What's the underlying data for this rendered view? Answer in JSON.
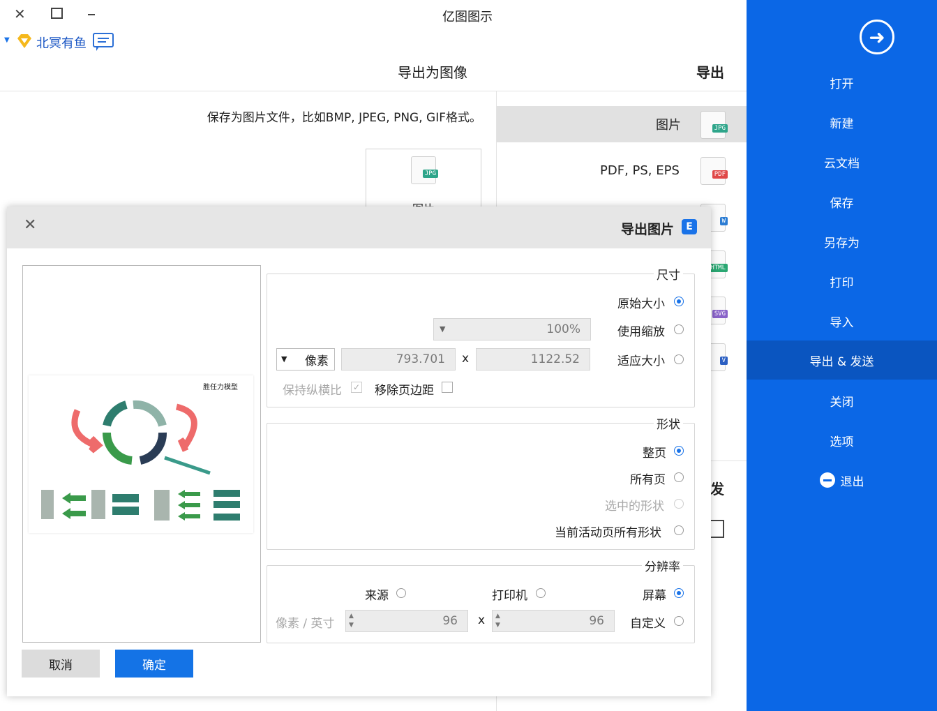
{
  "window": {
    "title": "亿图图示",
    "user_name": "北冥有鱼"
  },
  "header": {
    "section_title": "导出",
    "page_title": "导出为图像",
    "description": "保存为图片文件，比如BMP, JPEG, PNG, GIF格式。",
    "partial_side_text": "发"
  },
  "sidebar": {
    "items": [
      {
        "label": "打开"
      },
      {
        "label": "新建"
      },
      {
        "label": "云文档"
      },
      {
        "label": "保存"
      },
      {
        "label": "另存为"
      },
      {
        "label": "打印"
      },
      {
        "label": "导入"
      },
      {
        "label": "导出 & 发送"
      },
      {
        "label": "关闭"
      },
      {
        "label": "选项"
      },
      {
        "label": "退出"
      }
    ],
    "active_index": 7
  },
  "formats": [
    {
      "label": "图片",
      "badge": "JPG",
      "color": "#2ea58a"
    },
    {
      "label": "PDF, PS, EPS",
      "badge": "PDF",
      "color": "#e04848"
    },
    {
      "label": "",
      "badge": "W",
      "color": "#2b7cd3"
    },
    {
      "label": "",
      "badge": "HTML",
      "color": "#2aa772"
    },
    {
      "label": "",
      "badge": "SVG",
      "color": "#8a63c9"
    },
    {
      "label": "",
      "badge": "V",
      "color": "#2b5fc2"
    }
  ],
  "tile": {
    "label": "图片",
    "badge": "JPG"
  },
  "dialog": {
    "title": "导出图片",
    "size": {
      "title": "尺寸",
      "opt_original": "原始大小",
      "opt_scale": "使用缩放",
      "scale_value": "100%",
      "opt_fit": "适应大小",
      "width": "1122.52",
      "x_sign": "x",
      "height": "793.701",
      "unit": "像素",
      "remove_margin": "移除页边距",
      "keep_ratio": "保持纵横比",
      "selected": "原始大小"
    },
    "shape": {
      "title": "形状",
      "opt_page": "整页",
      "opt_all": "所有页",
      "opt_selected": "选中的形状",
      "opt_active_page": "当前活动页所有形状",
      "selected": "整页"
    },
    "resolution": {
      "title": "分辨率",
      "opt_screen": "屏幕",
      "opt_printer": "打印机",
      "opt_source": "来源",
      "opt_custom": "自定义",
      "x_value": "96",
      "x_sign": "x",
      "y_value": "96",
      "unit": "像素 / 英寸",
      "selected": "屏幕"
    },
    "ok_label": "确定",
    "cancel_label": "取消",
    "preview_title": "胜任力模型"
  },
  "colors": {
    "brand_blue": "#0b67e6",
    "active_blue": "#0a55c0",
    "ok_blue": "#1473e6",
    "teal": "#2e7d6e",
    "green": "#3a9a4a",
    "red": "#ee6b6b",
    "navy": "#2a3c55"
  }
}
